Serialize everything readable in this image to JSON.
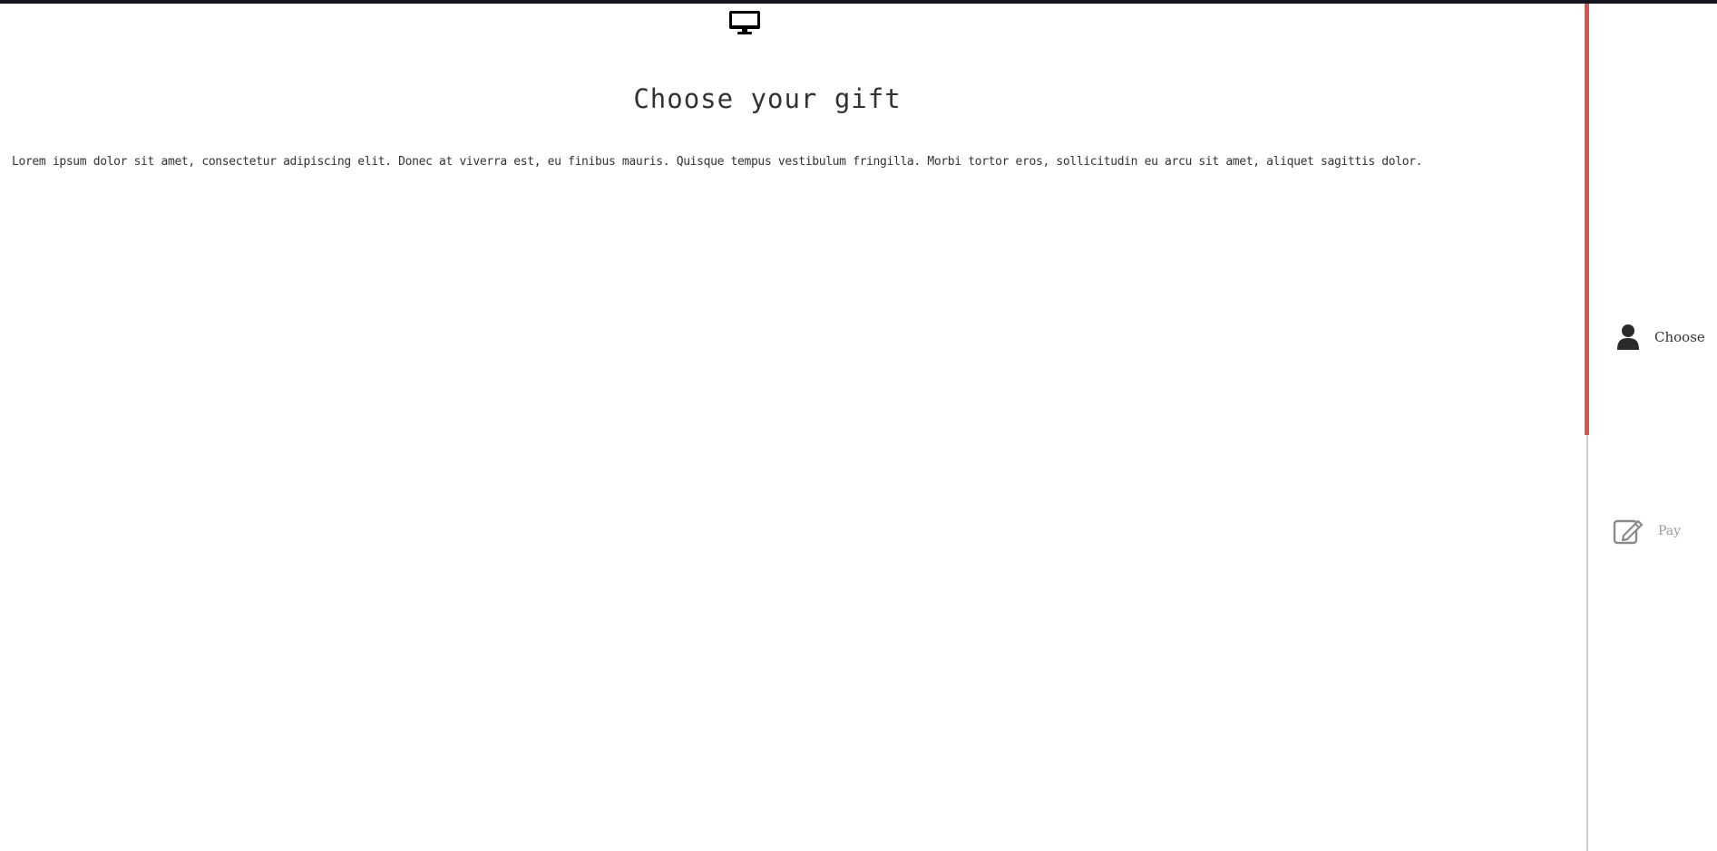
{
  "page": {
    "title": "Choose your gift",
    "intro": "Lorem ipsum dolor sit amet, consectetur adipiscing elit. Donec at viverra est, eu finibus mauris. Quisque tempus vestibulum fringilla. Morbi tortor eros, sollicitudin eu arcu sit amet, aliquet sagittis dolor.",
    "header_icon": "monitor-icon"
  },
  "steps": {
    "progress_fraction": 0.5,
    "items": [
      {
        "label": "Choose",
        "icon": "user-icon",
        "state": "active"
      },
      {
        "label": "Pay",
        "icon": "edit-icon",
        "state": "inactive"
      }
    ]
  },
  "colors": {
    "accent": "#d9534f",
    "top_bar": "#15151f",
    "text": "#333333",
    "inactive": "#9a9a9a",
    "rail": "#cfcfcf"
  }
}
